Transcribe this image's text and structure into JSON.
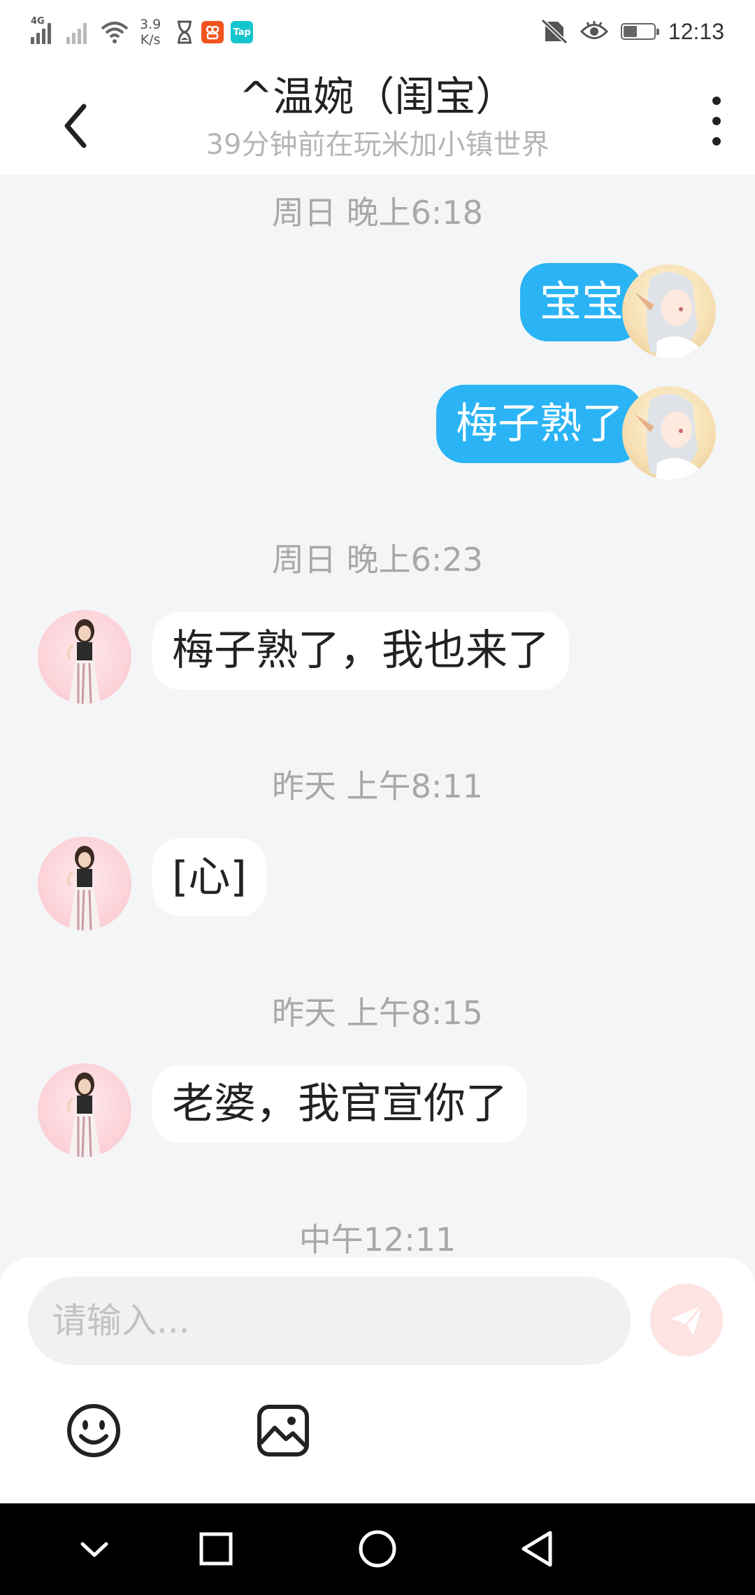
{
  "status_bar": {
    "net_type": "4G",
    "net_speed_value": "3.9",
    "net_speed_unit": "K/s",
    "app_badge_2": "Tap",
    "time": "12:13",
    "battery_level": 0.45
  },
  "header": {
    "title": "^温婉（闺宝）",
    "subtitle": "39分钟前在玩米加小镇世界"
  },
  "messages": [
    {
      "type": "timestamp",
      "text": "周日 晚上6:18"
    },
    {
      "type": "bubble",
      "from": "me",
      "text": "宝宝"
    },
    {
      "type": "bubble",
      "from": "me",
      "text": "梅子熟了"
    },
    {
      "type": "timestamp",
      "text": "周日 晚上6:23"
    },
    {
      "type": "bubble",
      "from": "them",
      "text": "梅子熟了，我也来了"
    },
    {
      "type": "timestamp",
      "text": "昨天 上午8:11"
    },
    {
      "type": "bubble",
      "from": "them",
      "text": "[心]"
    },
    {
      "type": "timestamp",
      "text": "昨天 上午8:15"
    },
    {
      "type": "bubble",
      "from": "them",
      "text": "老婆，我官宣你了"
    },
    {
      "type": "timestamp",
      "text": "中午12:11"
    }
  ],
  "input": {
    "placeholder": "请输入..."
  },
  "colors": {
    "my_bubble": "#2ab4f5",
    "their_bubble": "#ffffff",
    "background": "#f4f5f7",
    "send_button": "#fde3e1"
  },
  "icons": [
    "back-arrow-icon",
    "more-vertical-icon",
    "emoji-icon",
    "image-icon",
    "send-icon",
    "nav-collapse-icon",
    "nav-recents-icon",
    "nav-home-icon",
    "nav-back-icon"
  ]
}
